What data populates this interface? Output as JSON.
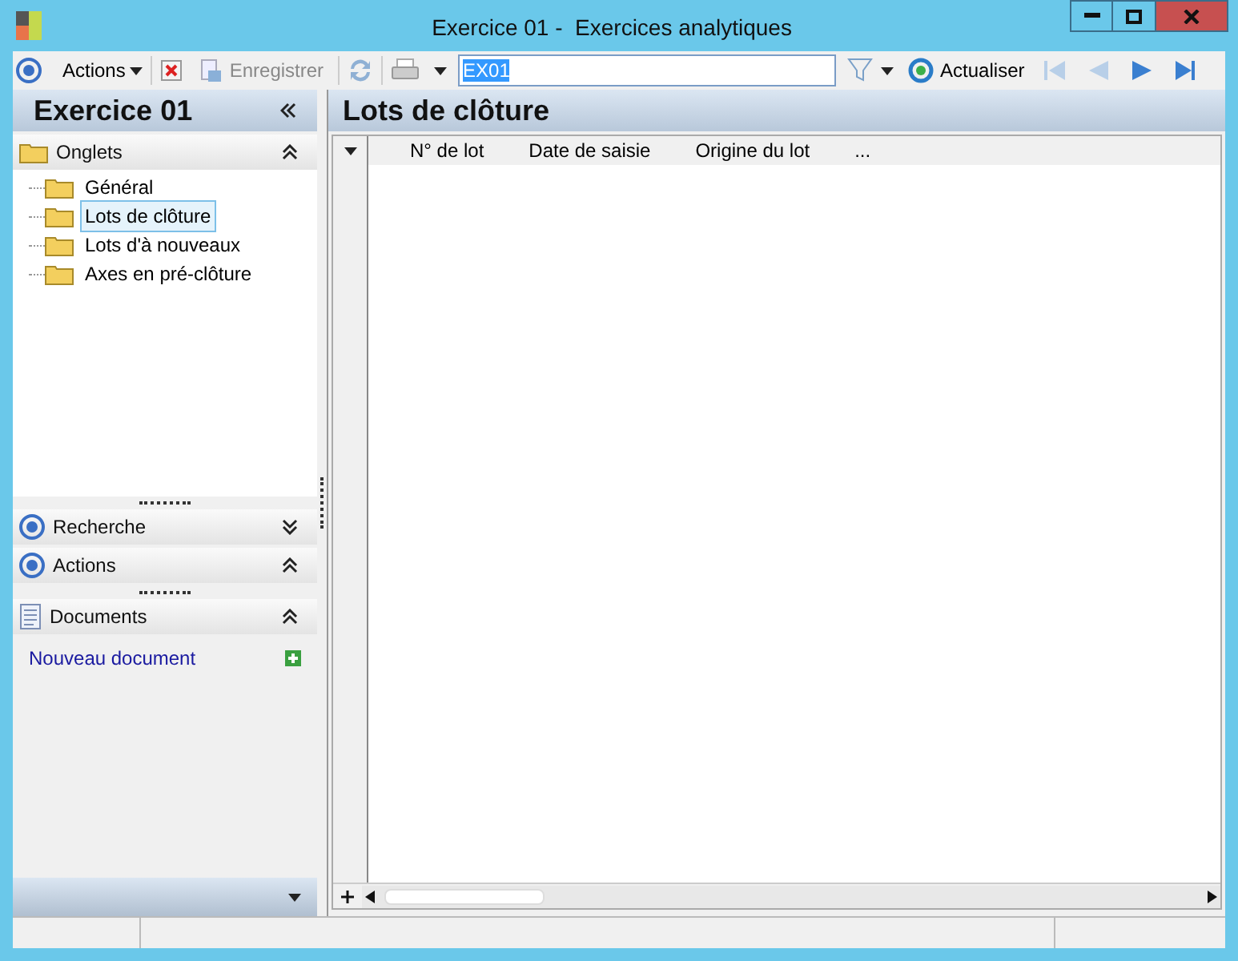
{
  "window": {
    "title": "Exercice 01 -  Exercices analytiques"
  },
  "toolbar": {
    "actions_label": "Actions",
    "save_label": "Enregistrer",
    "search_value": "EX01",
    "refresh_label": "Actualiser"
  },
  "sidebar": {
    "title": "Exercice 01",
    "sections": [
      {
        "kind": "tree",
        "title": "Onglets",
        "expanded": true,
        "items": [
          {
            "label": "Général",
            "selected": false
          },
          {
            "label": "Lots de clôture",
            "selected": true
          },
          {
            "label": "Lots d'à nouveaux",
            "selected": false
          },
          {
            "label": "Axes en pré-clôture",
            "selected": false
          }
        ]
      },
      {
        "kind": "panel",
        "title": "Recherche",
        "expanded": false
      },
      {
        "kind": "panel",
        "title": "Actions",
        "expanded": true
      },
      {
        "kind": "documents",
        "title": "Documents",
        "expanded": true,
        "link": "Nouveau document"
      }
    ]
  },
  "content": {
    "title": "Lots de clôture",
    "columns": [
      "N° de lot",
      "Date de saisie",
      "Origine du lot",
      "..."
    ]
  }
}
